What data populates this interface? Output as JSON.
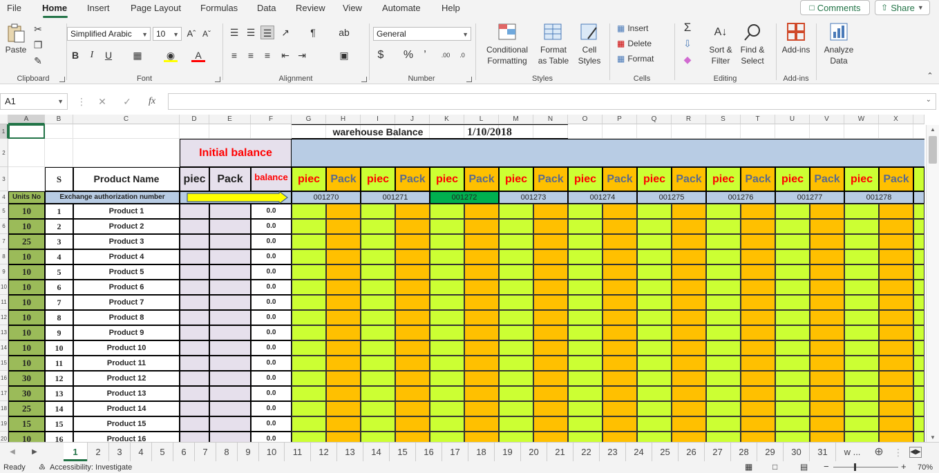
{
  "menu": {
    "tabs": [
      "File",
      "Home",
      "Insert",
      "Page Layout",
      "Formulas",
      "Data",
      "Review",
      "View",
      "Automate",
      "Help"
    ],
    "comments": "Comments",
    "share": "Share"
  },
  "ribbon": {
    "clipboard": {
      "paste": "Paste",
      "label": "Clipboard"
    },
    "font": {
      "name": "Simplified Arabic",
      "size": "10",
      "label": "Font"
    },
    "alignment": {
      "label": "Alignment"
    },
    "number": {
      "format": "General",
      "label": "Number"
    },
    "styles": {
      "conditional": "Conditional Formatting",
      "format_table": "Format as Table",
      "cell_styles": "Cell Styles",
      "label": "Styles"
    },
    "cells": {
      "insert": "Insert",
      "delete": "Delete",
      "format": "Format",
      "label": "Cells"
    },
    "editing": {
      "sort": "Sort & Filter",
      "find": "Find & Select",
      "label": "Editing"
    },
    "addins": {
      "addins": "Add-ins",
      "label": "Add-ins"
    },
    "analyze": {
      "label": "Analyze Data"
    }
  },
  "formula_bar": {
    "name_box": "A1",
    "fx": "fx",
    "content": ""
  },
  "columns": [
    "A",
    "B",
    "C",
    "D",
    "E",
    "F",
    "G",
    "H",
    "I",
    "J",
    "K",
    "L",
    "M",
    "N",
    "O",
    "P",
    "Q",
    "R",
    "S",
    "T",
    "U",
    "V",
    "W",
    "X"
  ],
  "rows": [
    "1",
    "2",
    "3",
    "4",
    "5",
    "6",
    "7",
    "8",
    "9",
    "10",
    "11",
    "12",
    "13",
    "14",
    "15",
    "16",
    "17",
    "18",
    "19",
    "20"
  ],
  "sheet": {
    "title": "warehouse Balance",
    "date": "1/10/2018",
    "initial_balance": "Initial balance",
    "col_s": "S",
    "col_product": "Product Name",
    "col_piec": "piec",
    "col_pack": "Pack",
    "col_balance": "balance",
    "units_no": "Units No",
    "exchange": "Exchange authorization number",
    "auth_numbers": [
      "001270",
      "001271",
      "001272",
      "001273",
      "001274",
      "001275",
      "001276",
      "001277",
      "001278"
    ],
    "units": [
      "10",
      "10",
      "25",
      "10",
      "10",
      "10",
      "10",
      "10",
      "10",
      "10",
      "10",
      "30",
      "30",
      "25",
      "15",
      "10"
    ],
    "products": [
      "Product 1",
      "Product 2",
      "Product 3",
      "Product 4",
      "Product 5",
      "Product 6",
      "Product 7",
      "Product 8",
      "Product 9",
      "Product 10",
      "Product 11",
      "Product 12",
      "Product 13",
      "Product 14",
      "Product 15",
      "Product 16"
    ],
    "balance_value": "0.0"
  },
  "sheet_tabs": [
    "1",
    "2",
    "3",
    "4",
    "5",
    "6",
    "7",
    "8",
    "9",
    "10",
    "11",
    "12",
    "13",
    "14",
    "15",
    "16",
    "17",
    "18",
    "19",
    "20",
    "21",
    "22",
    "23",
    "24",
    "25",
    "26",
    "27",
    "28",
    "29",
    "30",
    "31",
    "w ..."
  ],
  "status": {
    "ready": "Ready",
    "accessibility": "Accessibility: Investigate",
    "zoom": "70%"
  },
  "colors": {
    "accent": "#217346",
    "light_green": "#ccff33",
    "orange": "#ffc000",
    "lavender": "#e6e0ec",
    "blue": "#b8cce4",
    "red": "#ff0000",
    "dark_green": "#00b050",
    "units_green": "#9bbb59"
  }
}
